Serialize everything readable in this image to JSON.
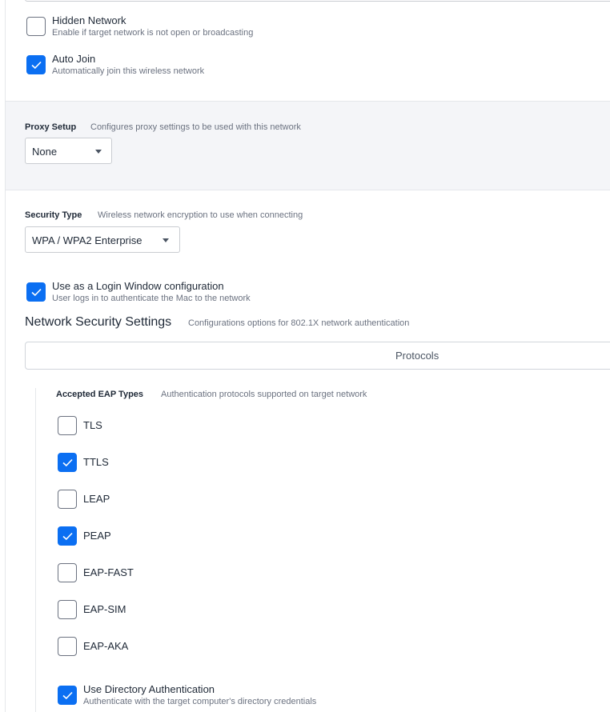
{
  "hidden_network": {
    "label": "Hidden Network",
    "description": "Enable if target network is not open or broadcasting",
    "checked": false
  },
  "auto_join": {
    "label": "Auto Join",
    "description": "Automatically join this wireless network",
    "checked": true
  },
  "proxy_setup": {
    "title": "Proxy Setup",
    "description": "Configures proxy settings to be used with this network",
    "value": "None"
  },
  "security_type": {
    "title": "Security Type",
    "description": "Wireless network encryption to use when connecting",
    "value": "WPA / WPA2 Enterprise"
  },
  "login_window": {
    "label": "Use as a Login Window configuration",
    "description": "User logs in to authenticate the Mac to the network",
    "checked": true
  },
  "network_security": {
    "title": "Network Security Settings",
    "description": "Configurations options for 802.1X network authentication"
  },
  "tabs": {
    "protocols": "Protocols"
  },
  "eap": {
    "title": "Accepted EAP Types",
    "description": "Authentication protocols supported on target network",
    "types": [
      {
        "label": "TLS",
        "checked": false
      },
      {
        "label": "TTLS",
        "checked": true
      },
      {
        "label": "LEAP",
        "checked": false
      },
      {
        "label": "PEAP",
        "checked": true
      },
      {
        "label": "EAP-FAST",
        "checked": false
      },
      {
        "label": "EAP-SIM",
        "checked": false
      },
      {
        "label": "EAP-AKA",
        "checked": false
      }
    ]
  },
  "directory_auth": {
    "label": "Use Directory Authentication",
    "description": "Authenticate with the target computer's directory credentials",
    "checked": true
  },
  "colors": {
    "accent": "#0b6ff2",
    "section_bg": "#f4f5f8"
  },
  "icons": {
    "check": "checkmark-icon",
    "caret": "caret-down-icon"
  }
}
